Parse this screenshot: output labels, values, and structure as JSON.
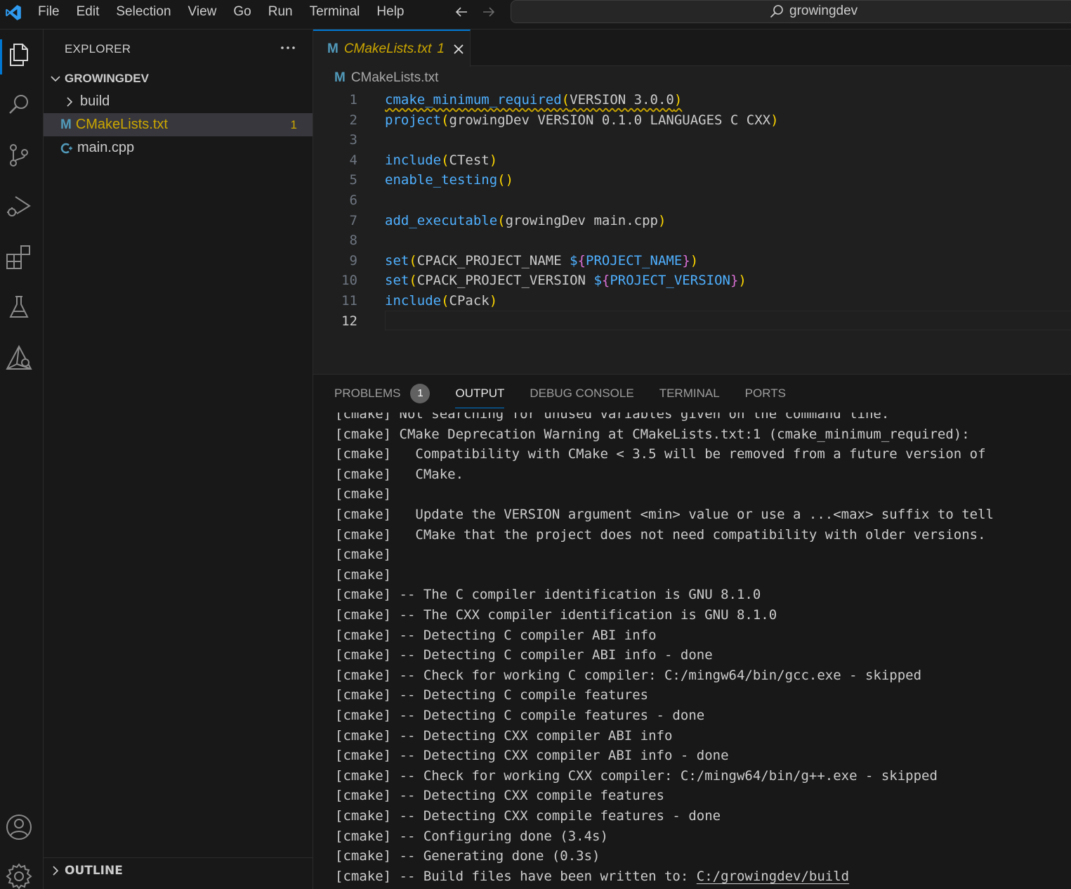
{
  "menu": [
    "File",
    "Edit",
    "Selection",
    "View",
    "Go",
    "Run",
    "Terminal",
    "Help"
  ],
  "command_center": {
    "text": "growingdev"
  },
  "sidebar": {
    "title": "EXPLORER",
    "folder": "GROWINGDEV",
    "items": [
      {
        "label": "build",
        "type": "folder"
      },
      {
        "label": "CMakeLists.txt",
        "type": "cmake",
        "badge": "1"
      },
      {
        "label": "main.cpp",
        "type": "cpp"
      }
    ],
    "outline": "OUTLINE"
  },
  "editor": {
    "tab": {
      "label": "CMakeLists.txt",
      "count": "1"
    },
    "breadcrumb": "CMakeLists.txt",
    "lines": [
      {
        "n": "1",
        "tokens": [
          [
            "fn squig",
            "cmake_minimum_required"
          ],
          [
            "pn squig",
            "("
          ],
          [
            "tx squig",
            "VERSION 3.0.0"
          ],
          [
            "pn squig",
            ")"
          ]
        ]
      },
      {
        "n": "2",
        "tokens": [
          [
            "fn",
            "project"
          ],
          [
            "pn",
            "("
          ],
          [
            "tx",
            "growingDev VERSION 0.1.0 LANGUAGES C CXX"
          ],
          [
            "pn",
            ")"
          ]
        ]
      },
      {
        "n": "3",
        "tokens": []
      },
      {
        "n": "4",
        "tokens": [
          [
            "fn",
            "include"
          ],
          [
            "pn",
            "("
          ],
          [
            "tx",
            "CTest"
          ],
          [
            "pn",
            ")"
          ]
        ]
      },
      {
        "n": "5",
        "tokens": [
          [
            "fn",
            "enable_testing"
          ],
          [
            "pn",
            "()"
          ]
        ]
      },
      {
        "n": "6",
        "tokens": []
      },
      {
        "n": "7",
        "tokens": [
          [
            "fn",
            "add_executable"
          ],
          [
            "pn",
            "("
          ],
          [
            "tx",
            "growingDev main.cpp"
          ],
          [
            "pn",
            ")"
          ]
        ]
      },
      {
        "n": "8",
        "tokens": []
      },
      {
        "n": "9",
        "tokens": [
          [
            "fn",
            "set"
          ],
          [
            "pn",
            "("
          ],
          [
            "tx",
            "CPACK_PROJECT_NAME "
          ],
          [
            "fn",
            "$"
          ],
          [
            "pn2",
            "{"
          ],
          [
            "var",
            "PROJECT_NAME"
          ],
          [
            "pn2",
            "}"
          ],
          [
            "pn",
            ")"
          ]
        ]
      },
      {
        "n": "10",
        "tokens": [
          [
            "fn",
            "set"
          ],
          [
            "pn",
            "("
          ],
          [
            "tx",
            "CPACK_PROJECT_VERSION "
          ],
          [
            "fn",
            "$"
          ],
          [
            "pn2",
            "{"
          ],
          [
            "var",
            "PROJECT_VERSION"
          ],
          [
            "pn2",
            "}"
          ],
          [
            "pn",
            ")"
          ]
        ]
      },
      {
        "n": "11",
        "tokens": [
          [
            "fn",
            "include"
          ],
          [
            "pn",
            "("
          ],
          [
            "tx",
            "CPack"
          ],
          [
            "pn",
            ")"
          ]
        ]
      },
      {
        "n": "12",
        "tokens": []
      }
    ]
  },
  "panel": {
    "tabs": [
      {
        "label": "PROBLEMS",
        "badge": "1"
      },
      {
        "label": "OUTPUT",
        "active": true
      },
      {
        "label": "DEBUG CONSOLE"
      },
      {
        "label": "TERMINAL"
      },
      {
        "label": "PORTS"
      }
    ],
    "output": [
      "[cmake] Not searching for unused variables given on the command line.",
      "[cmake] CMake Deprecation Warning at CMakeLists.txt:1 (cmake_minimum_required):",
      "[cmake]   Compatibility with CMake < 3.5 will be removed from a future version of",
      "[cmake]   CMake.",
      "[cmake]",
      "[cmake]   Update the VERSION argument <min> value or use a ...<max> suffix to tell",
      "[cmake]   CMake that the project does not need compatibility with older versions.",
      "[cmake]",
      "[cmake]",
      "[cmake] -- The C compiler identification is GNU 8.1.0",
      "[cmake] -- The CXX compiler identification is GNU 8.1.0",
      "[cmake] -- Detecting C compiler ABI info",
      "[cmake] -- Detecting C compiler ABI info - done",
      "[cmake] -- Check for working C compiler: C:/mingw64/bin/gcc.exe - skipped",
      "[cmake] -- Detecting C compile features",
      "[cmake] -- Detecting C compile features - done",
      "[cmake] -- Detecting CXX compiler ABI info",
      "[cmake] -- Detecting CXX compiler ABI info - done",
      "[cmake] -- Check for working CXX compiler: C:/mingw64/bin/g++.exe - skipped",
      "[cmake] -- Detecting CXX compile features",
      "[cmake] -- Detecting CXX compile features - done",
      "[cmake] -- Configuring done (3.4s)",
      "[cmake] -- Generating done (0.3s)"
    ],
    "last_line_prefix": "[cmake] -- Build files have been written to: ",
    "last_line_link": "C:/growingdev/build"
  },
  "colors": {
    "accent": "#0078d4",
    "warning": "#cca700",
    "function": "#4fb0ff",
    "bracket": "#ffd700"
  }
}
